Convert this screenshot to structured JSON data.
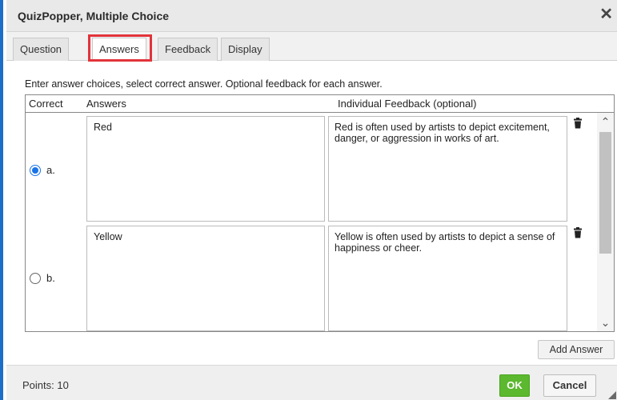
{
  "dialog": {
    "title": "QuizPopper, Multiple Choice",
    "close_icon": "close-icon"
  },
  "tabs": [
    {
      "label": "Question",
      "active": false
    },
    {
      "label": "Answers",
      "active": true
    },
    {
      "label": "Feedback",
      "active": false
    },
    {
      "label": "Display",
      "active": false
    }
  ],
  "instructions": "Enter answer choices, select correct answer. Optional feedback for each answer.",
  "table": {
    "headers": {
      "correct": "Correct",
      "answers": "Answers",
      "feedback": "Individual Feedback (optional)"
    },
    "rows": [
      {
        "label": "a.",
        "selected": true,
        "answer": "Red",
        "feedback": "Red is often used by artists to depict excitement, danger, or aggression in works of art.",
        "delete_icon": "trash-icon"
      },
      {
        "label": "b.",
        "selected": false,
        "answer": "Yellow",
        "feedback": "Yellow is often used by artists to depict a sense of happiness or cheer.",
        "delete_icon": "trash-icon"
      }
    ]
  },
  "add_answer_label": "Add Answer",
  "footer": {
    "points": "Points: 10",
    "ok_label": "OK",
    "cancel_label": "Cancel"
  },
  "colors": {
    "accent": "#1c6ec8",
    "ok_green": "#5cb82e",
    "highlight_red": "#e2333b",
    "radio_blue": "#1a73e8"
  }
}
